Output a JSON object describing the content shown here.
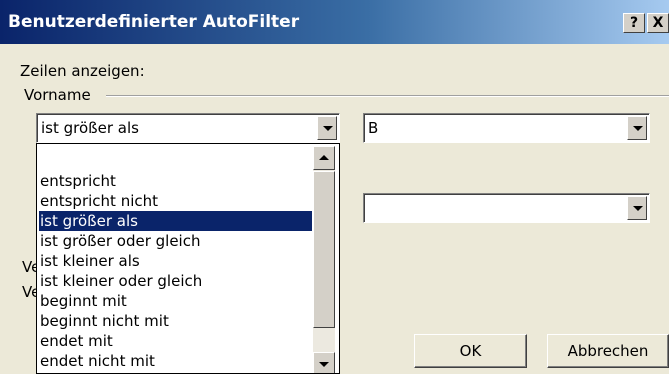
{
  "window": {
    "title": "Benutzerdefinierter AutoFilter",
    "help_label": "?",
    "close_label": "X"
  },
  "form": {
    "rows_label": "Zeilen anzeigen:",
    "field_label": "Vorname",
    "condition1": {
      "operator": "ist größer als",
      "value": "B"
    },
    "condition2": {
      "value": ""
    },
    "partial_labels": [
      "Ve",
      "Ve"
    ]
  },
  "dropdown": {
    "items": [
      "entspricht",
      "entspricht nicht",
      "ist größer als",
      "ist größer oder gleich",
      "ist kleiner als",
      "ist kleiner oder gleich",
      "beginnt mit",
      "beginnt nicht mit",
      "endet mit",
      "endet nicht mit"
    ],
    "selected_index": 2
  },
  "buttons": {
    "ok": "OK",
    "cancel": "Abbrechen"
  },
  "colors": {
    "title_gradient_start": "#0a246a",
    "selection": "#0a246a",
    "dialog_bg": "#ece9d8"
  },
  "icons": {
    "dropdown_arrow": "chevron-down-icon",
    "scroll_up": "scroll-up-icon",
    "scroll_down": "scroll-down-icon"
  }
}
